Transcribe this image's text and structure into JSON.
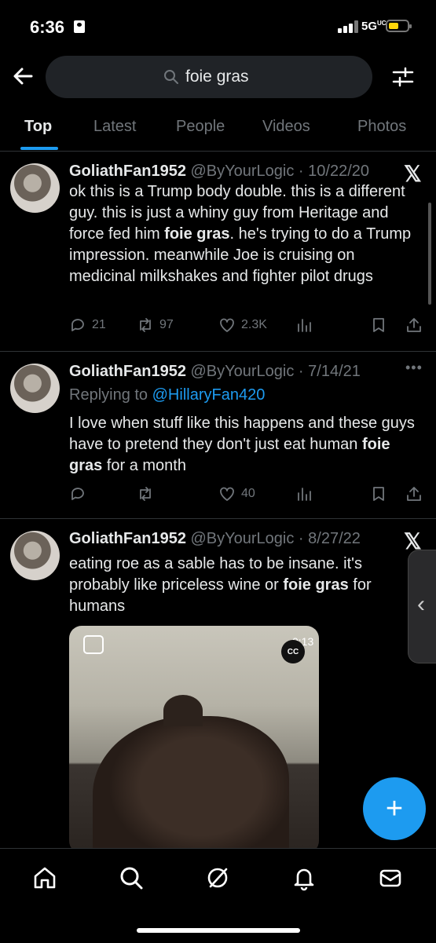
{
  "status_bar": {
    "time": "6:36",
    "network": "5G",
    "network_suffix": "UC"
  },
  "search": {
    "query": "foie gras"
  },
  "tabs": [
    {
      "label": "Top",
      "active": true
    },
    {
      "label": "Latest"
    },
    {
      "label": "People"
    },
    {
      "label": "Videos"
    },
    {
      "label": "Photos"
    }
  ],
  "tweets": [
    {
      "name": "GoliathFan1952",
      "handle": "@ByYourLogic",
      "date": "10/22/20",
      "body_parts": [
        "ok this is a Trump body double. this is a different guy. this is just a whiny guy from Heritage and force fed him ",
        "foie gras",
        ". he's trying to do a Trump impression. meanwhile Joe is cruising on medicinal milkshakes and fighter pilot drugs"
      ],
      "replies": "21",
      "retweets": "97",
      "likes": "2.3K"
    },
    {
      "name": "GoliathFan1952",
      "handle": "@ByYourLogic",
      "date": "7/14/21",
      "replying_label": "Replying to",
      "replying_to": "@HillaryFan420",
      "body_parts": [
        "I love when stuff like this happens and these guys have to pretend they don't just eat human ",
        "foie gras",
        " for a month"
      ],
      "likes": "40"
    },
    {
      "name": "GoliathFan1952",
      "handle": "@ByYourLogic",
      "date": "8/27/22",
      "body_parts": [
        "eating roe as a sable has to be insane. it's probably like priceless wine or ",
        "foie gras",
        " for humans"
      ],
      "media_duration": "0:13",
      "media_cc": "CC"
    }
  ],
  "colors": {
    "accent": "#1d9bf0",
    "muted": "#71767b",
    "text": "#e7e9ea",
    "background": "#000000"
  }
}
